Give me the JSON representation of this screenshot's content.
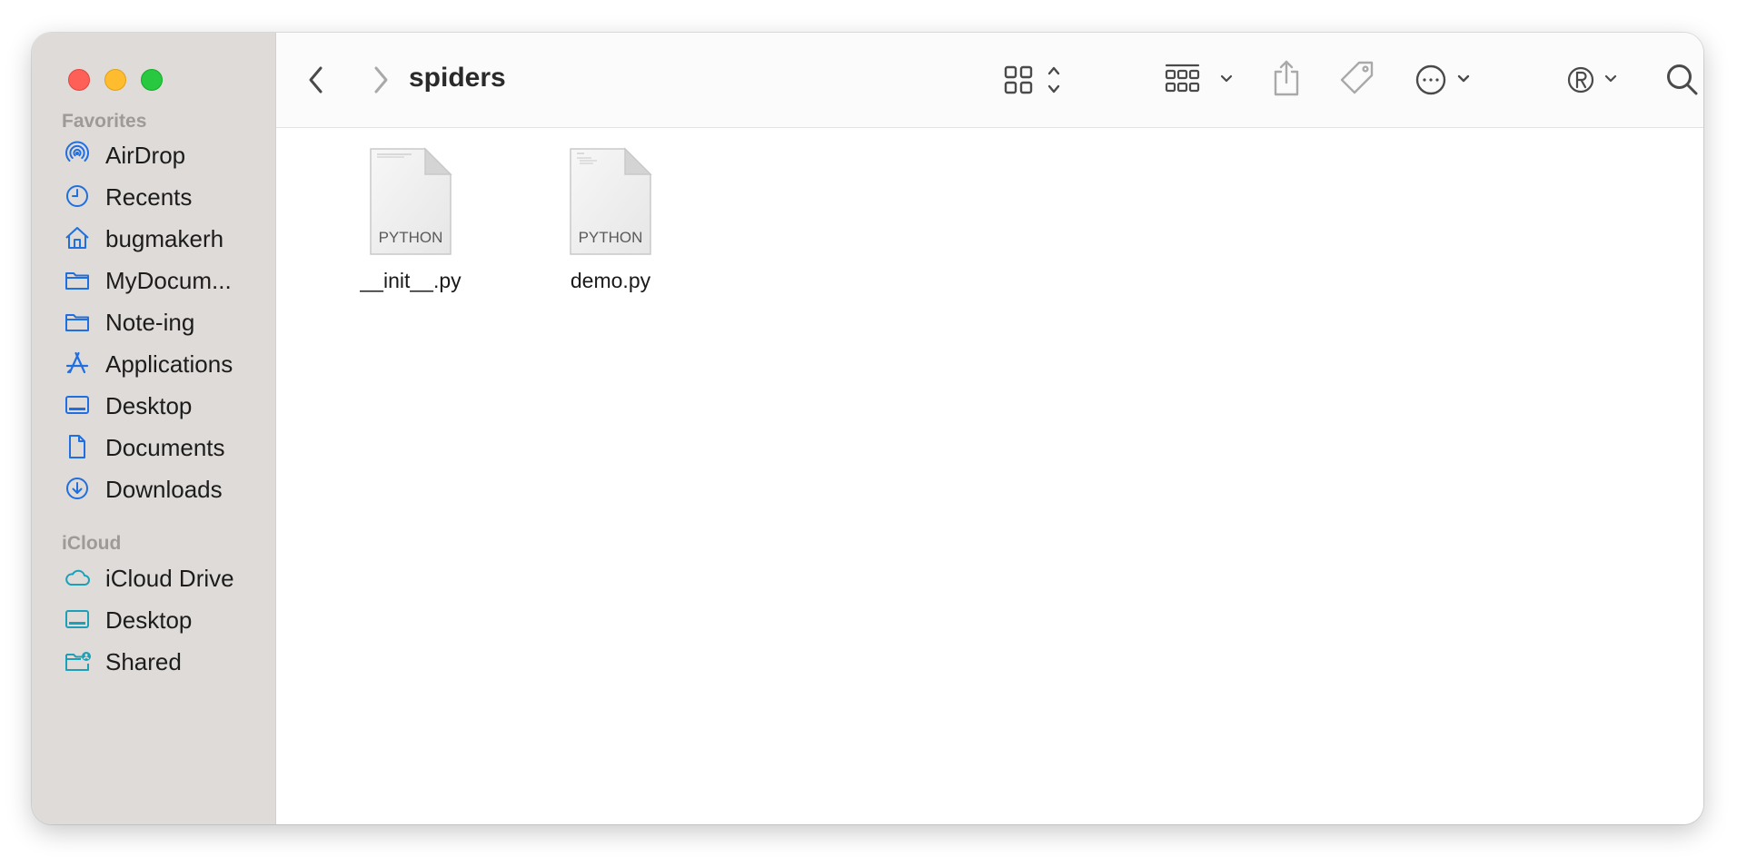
{
  "window": {
    "title": "spiders"
  },
  "sidebar": {
    "favorites_label": "Favorites",
    "favorites": [
      {
        "label": "AirDrop",
        "icon": "airdrop-icon"
      },
      {
        "label": "Recents",
        "icon": "clock-icon"
      },
      {
        "label": "bugmakerh",
        "icon": "home-icon"
      },
      {
        "label": "MyDocum...",
        "icon": "folder-icon"
      },
      {
        "label": "Note-ing",
        "icon": "folder-icon"
      },
      {
        "label": "Applications",
        "icon": "applications-icon"
      },
      {
        "label": "Desktop",
        "icon": "desktop-icon"
      },
      {
        "label": "Documents",
        "icon": "document-icon"
      },
      {
        "label": "Downloads",
        "icon": "download-icon"
      }
    ],
    "icloud_label": "iCloud",
    "icloud": [
      {
        "label": "iCloud Drive",
        "icon": "cloud-icon"
      },
      {
        "label": "Desktop",
        "icon": "desktop-icon"
      },
      {
        "label": "Shared",
        "icon": "shared-folder-icon"
      }
    ]
  },
  "files": [
    {
      "name": "__init__.py",
      "type_label": "PYTHON"
    },
    {
      "name": "demo.py",
      "type_label": "PYTHON"
    }
  ],
  "colors": {
    "accent": "#1f6fe0",
    "icloud_accent": "#1aa0b8",
    "sidebar_bg": "#dedbd8"
  }
}
